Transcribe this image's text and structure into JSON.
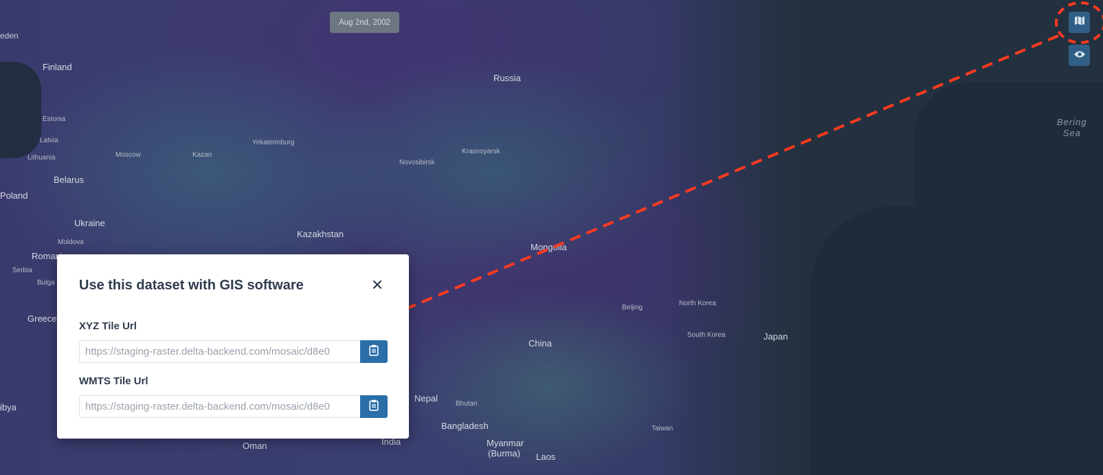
{
  "map": {
    "date": "Aug 2nd, 2002",
    "labels": {
      "sweden": "eden",
      "finland": "Finland",
      "russia": "Russia",
      "estonia": "Estonia",
      "latvia": "Latvia",
      "lithuania": "Lithuania",
      "moscow": "Moscow",
      "kazan": "Kazan",
      "yekaterinburg": "Yekaterinburg",
      "novosibirsk": "Novosibirsk",
      "krasnoyarsk": "Krasnoyarsk",
      "belarus": "Belarus",
      "poland": "Poland",
      "ukraine": "Ukraine",
      "moldova": "Moldova",
      "romania": "Romania",
      "serbia": "Serbia",
      "bulgaria": "Bulga",
      "greece": "Greece",
      "libya": "ibya",
      "kazakhstan": "Kazakhstan",
      "mongolia": "Mongolia",
      "beijing": "Beijing",
      "north_korea": "North Korea",
      "south_korea": "South Korea",
      "japan": "Japan",
      "china": "China",
      "nepal": "Nepal",
      "bhutan": "Bhutan",
      "bangladesh": "Bangladesh",
      "india": "India",
      "oman": "Oman",
      "myanmar": "Myanmar",
      "burma": "(Burma)",
      "laos": "Laos",
      "taiwan": "Taiwan",
      "bering_sea_1": "Bering",
      "bering_sea_2": "Sea"
    }
  },
  "controls": {
    "layers_icon": "map-icon",
    "visibility_icon": "eye-icon",
    "button_color": "#2f5f86"
  },
  "annotation": {
    "color": "#ff3b1f"
  },
  "modal": {
    "title": "Use this dataset with GIS software",
    "close_icon": "close-icon",
    "xyz": {
      "label": "XYZ Tile Url",
      "value": "https://staging-raster.delta-backend.com/mosaic/d8e0"
    },
    "wmts": {
      "label": "WMTS Tile Url",
      "value": "https://staging-raster.delta-backend.com/mosaic/d8e0"
    },
    "copy_icon": "clipboard-icon",
    "accent": "#2a6fa8"
  }
}
